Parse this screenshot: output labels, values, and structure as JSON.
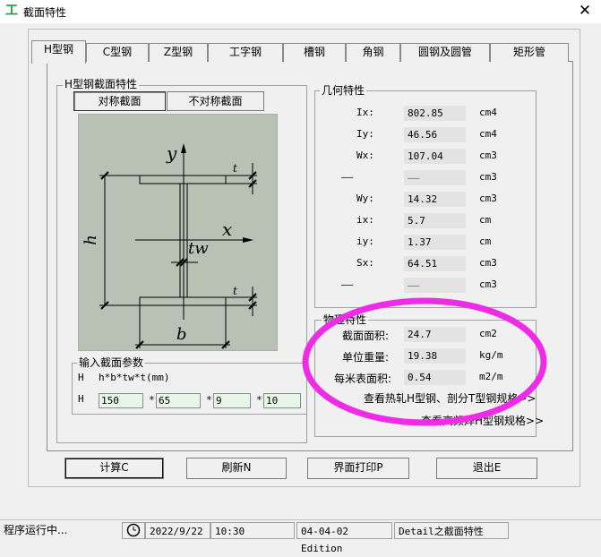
{
  "window": {
    "title": "截面特性",
    "close": "✕"
  },
  "tabs": [
    "H型钢",
    "C型钢",
    "Z型钢",
    "工字钢",
    "槽钢",
    "角钢",
    "圆钢及圆管",
    "矩形管"
  ],
  "hgroup": {
    "title": "H型钢截面特性",
    "sym": "对称截面",
    "asym": "不对称截面"
  },
  "diagram": {
    "y": "y",
    "x": "x",
    "h": "h",
    "tw": "tw",
    "b": "b",
    "t_top": "t",
    "t_bot": "t"
  },
  "input": {
    "title": "输入截面参数",
    "type_label": "H",
    "formula": "h*b*tw*t(mm)",
    "row_label": "H",
    "star": "*",
    "values": [
      "150",
      "65",
      "9",
      "10"
    ]
  },
  "geometry": {
    "title": "几何特性",
    "rows": [
      {
        "label": "Ix:",
        "value": "802.85",
        "unit": "cm4"
      },
      {
        "label": "Iy:",
        "value": "46.56",
        "unit": "cm4"
      },
      {
        "label": "Wx:",
        "value": "107.04",
        "unit": "cm3"
      },
      {
        "label": "——",
        "value": "——",
        "unit": "cm3"
      },
      {
        "label": "Wy:",
        "value": "14.32",
        "unit": "cm3"
      },
      {
        "label": "ix:",
        "value": "5.7",
        "unit": "cm"
      },
      {
        "label": "iy:",
        "value": "1.37",
        "unit": "cm"
      },
      {
        "label": "Sx:",
        "value": "64.51",
        "unit": "cm3"
      },
      {
        "label": "——",
        "value": "——",
        "unit": "cm3"
      }
    ]
  },
  "physical": {
    "title": "物理特性",
    "rows": [
      {
        "label": "截面面积:",
        "value": "24.7",
        "unit": "cm2"
      },
      {
        "label": "单位重量:",
        "value": "19.38",
        "unit": "kg/m"
      },
      {
        "label": "每米表面积:",
        "value": "0.54",
        "unit": "m2/m"
      }
    ],
    "link1": "查看热轧H型钢、剖分T型钢规格>>",
    "link2": "查看高频焊H型钢规格>>"
  },
  "buttons": {
    "calc": "计算C",
    "refresh": "刷新N",
    "print": "界面打印P",
    "exit": "退出E"
  },
  "status": {
    "text": "程序运行中...",
    "date": "2022/9/22",
    "time": "10:30",
    "edition": "04-04-02 Edition",
    "detail": "Detail之截面特性"
  },
  "colors": {
    "annotation": "#ee2be6",
    "input_bg": "#e8f6e8",
    "diagram_bg": "#b9c1b4",
    "icon": "#1a9c3a"
  }
}
